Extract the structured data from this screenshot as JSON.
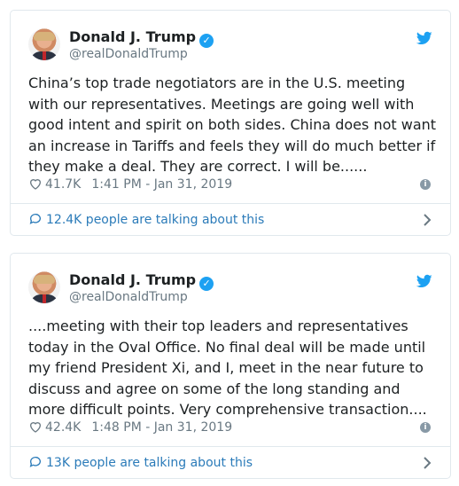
{
  "tweets": [
    {
      "name": "Donald J. Trump",
      "handle": "@realDonaldTrump",
      "text": "China’s top trade negotiators are in the U.S. meeting with our representatives. Meetings are going well with good intent and spirit on both sides. China does not want an increase in Tariffs and feels they will do much better if they make a deal. They are correct. I will be......",
      "likes": "41.7K",
      "timestamp": "1:41 PM - Jan 31, 2019",
      "talking": "12.4K people are talking about this"
    },
    {
      "name": "Donald J. Trump",
      "handle": "@realDonaldTrump",
      "text": "....meeting with their top leaders and representatives today in the Oval Office. No final deal will be made until my friend President Xi, and I, meet in the near future to discuss and agree on some of the long standing and more difficult points. Very comprehensive transaction....",
      "likes": "42.4K",
      "timestamp": "1:48 PM - Jan 31, 2019",
      "talking": "13K people are talking about this"
    }
  ],
  "colors": {
    "brand_blue": "#1da1f2",
    "link_blue": "#2b7bb9",
    "muted": "#697882",
    "border": "#e1e8ed",
    "text": "#1c2022"
  },
  "icons": [
    "verified-badge-icon",
    "twitter-bird-icon",
    "heart-icon",
    "info-icon",
    "chat-bubble-icon",
    "chevron-right-icon"
  ]
}
